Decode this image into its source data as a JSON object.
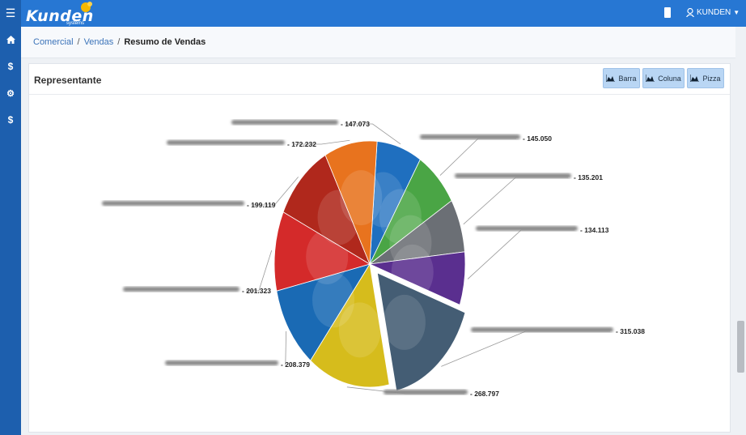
{
  "app": {
    "logo_text": "Kunden",
    "logo_sub": "systems",
    "user_label": "KUNDEN"
  },
  "breadcrumb": {
    "items": [
      "Comercial",
      "Vendas"
    ],
    "current": "Resumo de Vendas"
  },
  "panel": {
    "title": "Representante"
  },
  "buttons": {
    "bar": "Barra",
    "column": "Coluna",
    "pie": "Pizza"
  },
  "icons": {
    "menu": "hamburger-icon",
    "home": "home-icon",
    "dollar": "dollar-icon",
    "gears": "gears-icon",
    "user": "user-icon",
    "device": "mobile-icon",
    "chart": "area-chart-icon"
  },
  "colors": {
    "topbar": "#2777d3",
    "sidebar": "#1d5fae",
    "button": "#b9d6f4"
  },
  "chart_data": {
    "type": "pie",
    "title": "",
    "slices": [
      {
        "label": "",
        "value": 147073,
        "display": "147.073",
        "color": "#1f6fbf"
      },
      {
        "label": "",
        "value": 145050,
        "display": "145.050",
        "color": "#4aa545"
      },
      {
        "label": "",
        "value": 135201,
        "display": "135.201",
        "color": "#6b6f75"
      },
      {
        "label": "",
        "value": 134113,
        "display": "134.113",
        "color": "#5a2f8f"
      },
      {
        "label": "",
        "value": 315038,
        "display": "315.038",
        "color": "#445d74",
        "exploded": true
      },
      {
        "label": "",
        "value": 268797,
        "display": "268.797",
        "color": "#d6bc1c"
      },
      {
        "label": "",
        "value": 208379,
        "display": "208.379",
        "color": "#1a6ab4"
      },
      {
        "label": "",
        "value": 201323,
        "display": "201.323",
        "color": "#d42a2a"
      },
      {
        "label": "",
        "value": 199119,
        "display": "199.119",
        "color": "#b0281c"
      },
      {
        "label": "",
        "value": 172232,
        "display": "172.232",
        "color": "#e8731e"
      }
    ]
  }
}
